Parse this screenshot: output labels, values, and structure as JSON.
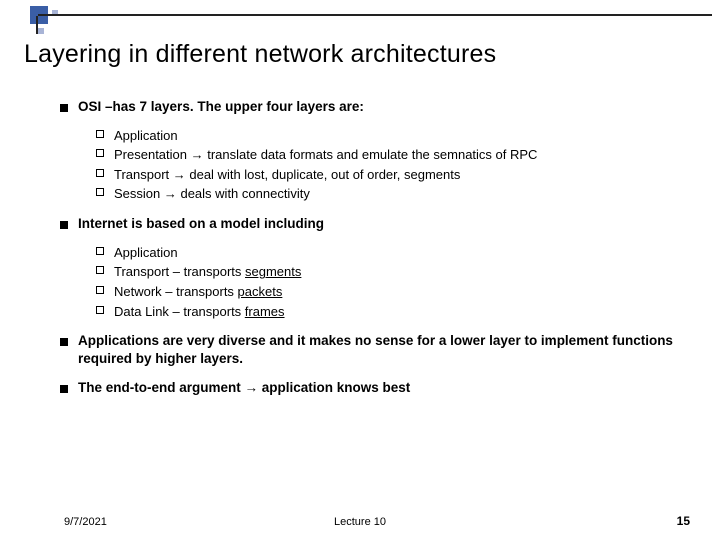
{
  "title": "Layering in different network architectures",
  "bullets": [
    {
      "text": "OSI –has 7 layers. The upper four layers are:",
      "sub": [
        {
          "text": "Application"
        },
        {
          "text": "Presentation → translate data formats and emulate the semnatics of RPC"
        },
        {
          "text": "Transport → deal with lost, duplicate, out of order, segments"
        },
        {
          "text": "Session → deals with connectivity"
        }
      ]
    },
    {
      "text": "Internet is based on a model including",
      "sub": [
        {
          "text": "Application"
        },
        {
          "html": "Transport – transports <span class=\"under\">segments</span>"
        },
        {
          "html": "Network – transports <span class=\"under\">packets</span>"
        },
        {
          "html": "Data Link – transports <span class=\"under\">frames</span>"
        }
      ]
    },
    {
      "text": "Applications are very diverse and it makes no sense for a lower layer to implement functions required by higher layers."
    },
    {
      "text": "The end-to-end argument → application knows best"
    }
  ],
  "footer": {
    "date": "9/7/2021",
    "center": "Lecture 10",
    "page": "15"
  }
}
